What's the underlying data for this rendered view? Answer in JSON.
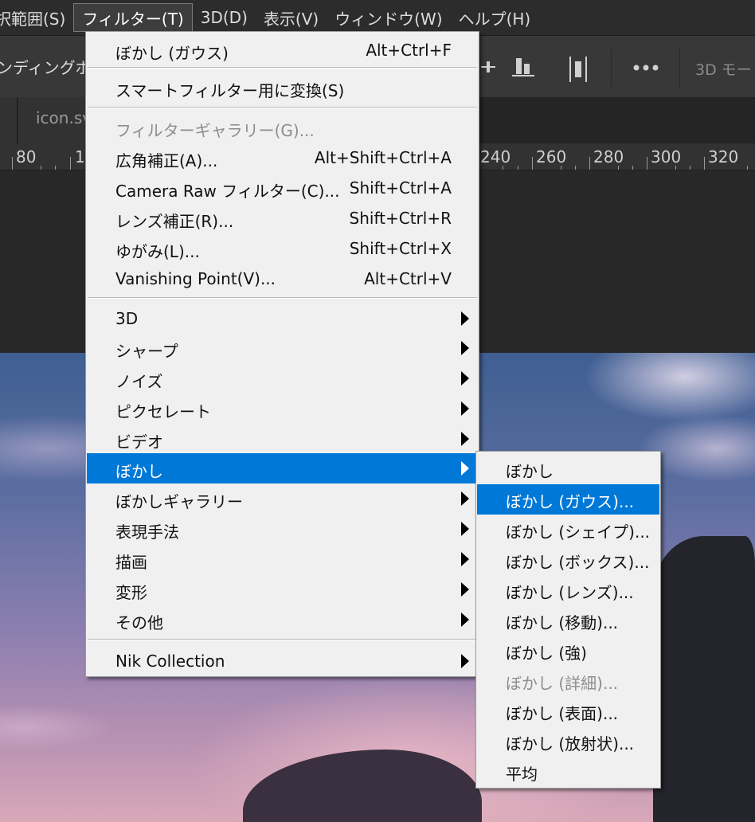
{
  "menubar": {
    "items": [
      {
        "label": "択範囲(S)",
        "open": false
      },
      {
        "label": "フィルター(T)",
        "open": true
      },
      {
        "label": "3D(D)",
        "open": false
      },
      {
        "label": "表示(V)",
        "open": false
      },
      {
        "label": "ウィンドウ(W)",
        "open": false
      },
      {
        "label": "ヘルプ(H)",
        "open": false
      }
    ]
  },
  "options_bar": {
    "left_label": "ンディングボ",
    "right_label": "3D モー",
    "icons": [
      "distribute-icon",
      "align-bottom-icon",
      "align-center-icon",
      "more-icon"
    ]
  },
  "tabs": {
    "document": "icon.sv"
  },
  "ruler": {
    "labels": [
      "80",
      "1",
      "240",
      "260",
      "280",
      "300",
      "320"
    ]
  },
  "filter_menu": {
    "items": [
      {
        "label": "ぼかし (ガウス)",
        "shortcut": "Alt+Ctrl+F"
      },
      {
        "separator": true
      },
      {
        "label": "スマートフィルター用に変換(S)"
      },
      {
        "separator": true
      },
      {
        "label": "フィルターギャラリー(G)...",
        "disabled": true
      },
      {
        "label": "広角補正(A)...",
        "shortcut": "Alt+Shift+Ctrl+A"
      },
      {
        "label": "Camera Raw フィルター(C)...",
        "shortcut": "Shift+Ctrl+A"
      },
      {
        "label": "レンズ補正(R)...",
        "shortcut": "Shift+Ctrl+R"
      },
      {
        "label": "ゆがみ(L)...",
        "shortcut": "Shift+Ctrl+X"
      },
      {
        "label": "Vanishing Point(V)...",
        "shortcut": "Alt+Ctrl+V"
      },
      {
        "separator": true
      },
      {
        "label": "3D",
        "submenu": true
      },
      {
        "label": "シャープ",
        "submenu": true
      },
      {
        "label": "ノイズ",
        "submenu": true
      },
      {
        "label": "ピクセレート",
        "submenu": true
      },
      {
        "label": "ビデオ",
        "submenu": true
      },
      {
        "label": "ぼかし",
        "submenu": true,
        "highlighted": true
      },
      {
        "label": "ぼかしギャラリー",
        "submenu": true
      },
      {
        "label": "表現手法",
        "submenu": true
      },
      {
        "label": "描画",
        "submenu": true
      },
      {
        "label": "変形",
        "submenu": true
      },
      {
        "label": "その他",
        "submenu": true
      },
      {
        "separator": true
      },
      {
        "label": "Nik Collection",
        "submenu": true
      }
    ]
  },
  "blur_submenu": {
    "items": [
      {
        "label": "ぼかし"
      },
      {
        "label": "ぼかし (ガウス)...",
        "highlighted": true
      },
      {
        "label": "ぼかし (シェイプ)..."
      },
      {
        "label": "ぼかし (ボックス)..."
      },
      {
        "label": "ぼかし (レンズ)..."
      },
      {
        "label": "ぼかし (移動)..."
      },
      {
        "label": "ぼかし (強)"
      },
      {
        "label": "ぼかし (詳細)...",
        "disabled": true
      },
      {
        "label": "ぼかし (表面)..."
      },
      {
        "label": "ぼかし (放射状)..."
      },
      {
        "label": "平均"
      }
    ]
  },
  "colors": {
    "menu_bg": "#f0f0f0",
    "highlight": "#0078d7",
    "app_chrome": "#383838"
  }
}
